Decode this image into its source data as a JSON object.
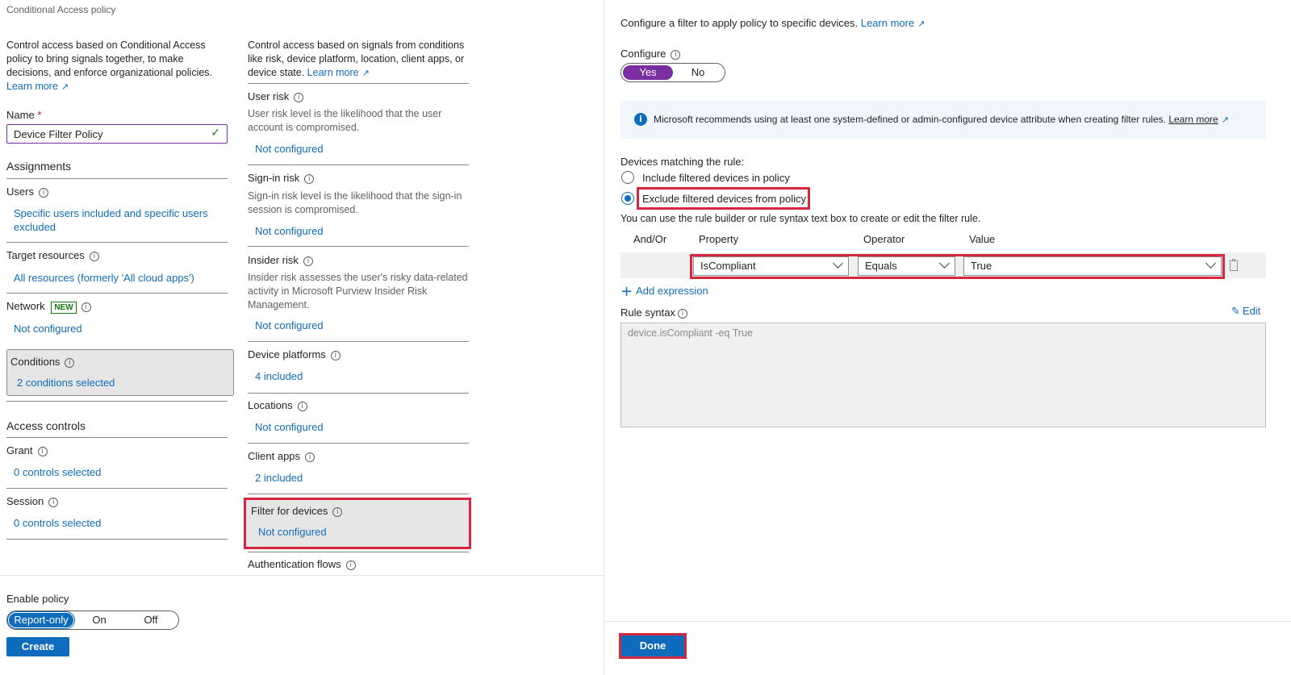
{
  "header": {
    "title": "Conditional Access policy"
  },
  "left": {
    "intro": "Control access based on Conditional Access policy to bring signals together, to make decisions, and enforce organizational policies.",
    "learn_more": "Learn more",
    "name_label": "Name",
    "name_required": "*",
    "name_value": "Device Filter Policy",
    "assignments_heading": "Assignments",
    "users_label": "Users",
    "users_value": "Specific users included and specific users excluded",
    "target_label": "Target resources",
    "target_value": "All resources (formerly 'All cloud apps')",
    "network_label": "Network",
    "network_badge": "NEW",
    "network_value": "Not configured",
    "conditions_label": "Conditions",
    "conditions_value": "2 conditions selected",
    "access_heading": "Access controls",
    "grant_label": "Grant",
    "grant_value": "0 controls selected",
    "session_label": "Session",
    "session_value": "0 controls selected",
    "enable_label": "Enable policy",
    "enable_options": [
      "Report-only",
      "On",
      "Off"
    ],
    "create_button": "Create"
  },
  "middle": {
    "intro": "Control access based on signals from conditions like risk, device platform, location, client apps, or device state.",
    "learn_more": "Learn more",
    "user_risk_label": "User risk",
    "user_risk_desc": "User risk level is the likelihood that the user account is compromised.",
    "user_risk_value": "Not configured",
    "signin_risk_label": "Sign-in risk",
    "signin_risk_desc": "Sign-in risk level is the likelihood that the sign-in session is compromised.",
    "signin_risk_value": "Not configured",
    "insider_risk_label": "Insider risk",
    "insider_risk_desc": "Insider risk assesses the user's risky data-related activity in Microsoft Purview Insider Risk Management.",
    "insider_risk_value": "Not configured",
    "platforms_label": "Device platforms",
    "platforms_value": "4 included",
    "locations_label": "Locations",
    "locations_value": "Not configured",
    "client_apps_label": "Client apps",
    "client_apps_value": "2 included",
    "filter_label": "Filter for devices",
    "filter_value": "Not configured",
    "auth_flows_label": "Authentication flows"
  },
  "right": {
    "intro": "Configure a filter to apply policy to specific devices.",
    "learn_more": "Learn more",
    "configure_label": "Configure",
    "configure_options": [
      "Yes",
      "No"
    ],
    "info_banner": "Microsoft recommends using at least one system-defined or admin-configured device attribute when creating filter rules.",
    "info_learn_more": "Learn more",
    "matching_label": "Devices matching the rule:",
    "radio_include": "Include filtered devices in policy",
    "radio_exclude": "Exclude filtered devices from policy",
    "builder_hint": "You can use the rule builder or rule syntax text box to create or edit the filter rule.",
    "col_andor": "And/Or",
    "col_property": "Property",
    "col_operator": "Operator",
    "col_value": "Value",
    "property_value": "IsCompliant",
    "operator_value": "Equals",
    "value_value": "True",
    "add_expression": "Add expression",
    "rule_syntax_label": "Rule syntax",
    "edit_label": "Edit",
    "rule_syntax_value": "device.isCompliant -eq True",
    "done_button": "Done"
  },
  "colors": {
    "accent": "#0f6cbd",
    "toggle_selected": "#7b2ea1",
    "highlight": "#d7263d"
  }
}
